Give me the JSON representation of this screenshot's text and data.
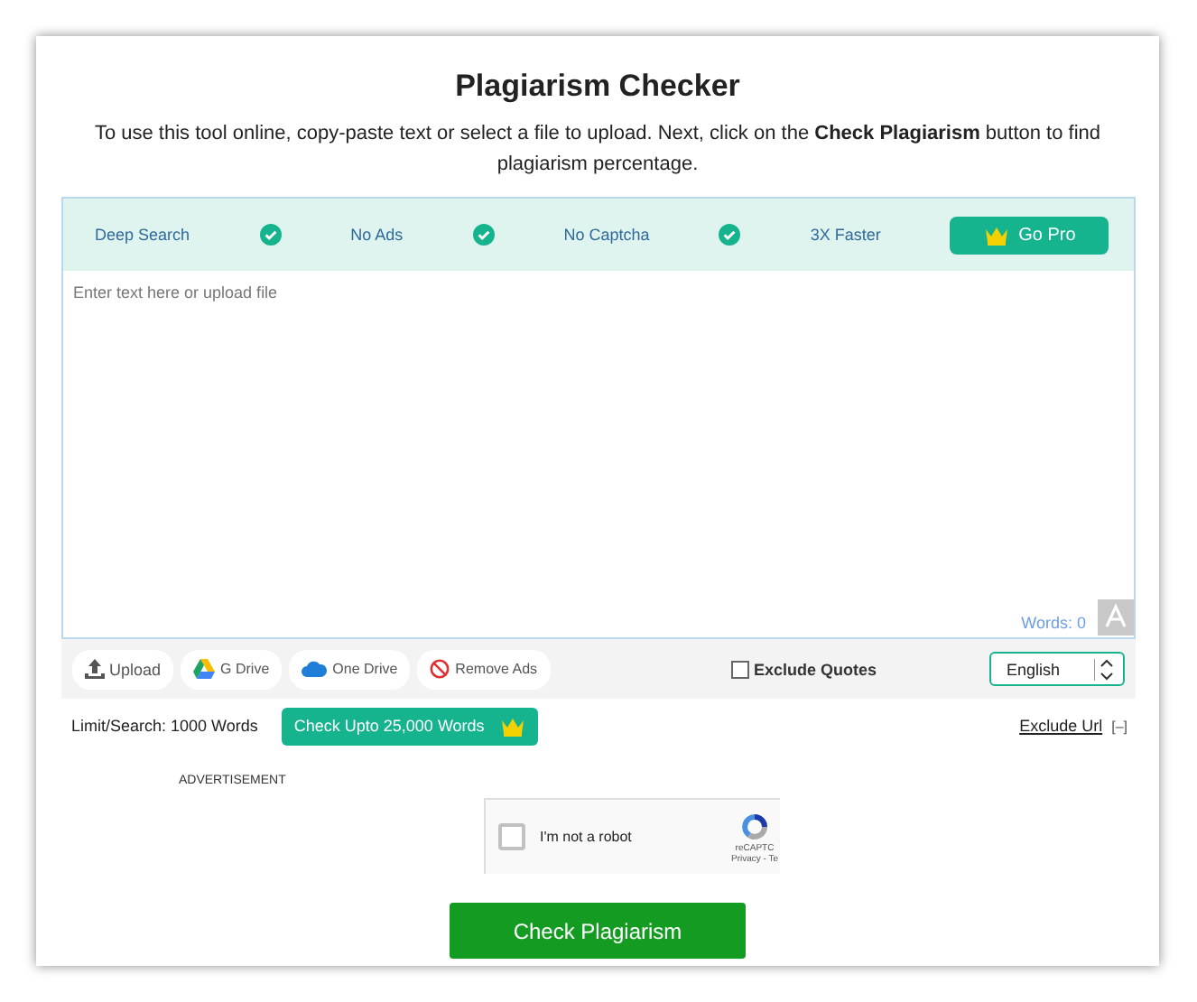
{
  "title": "Plagiarism Checker",
  "intro": "To use this tool online, copy-paste text or select a file to upload. Next, click on the **Check Plagiarism** button to find plagiarism percentage.",
  "features": [
    {
      "label": "Deep Search"
    },
    {
      "label": "No Ads"
    },
    {
      "label": "No Captcha"
    },
    {
      "label": "3X Faster"
    }
  ],
  "go_pro": "Go Pro",
  "editor": {
    "placeholder": "Enter text here or upload file",
    "word_count": "Words: 0"
  },
  "toolbar": [
    {
      "kind": "upload",
      "label": "Upload"
    },
    {
      "kind": "gdrive",
      "label": "G Drive"
    },
    {
      "kind": "onedrive",
      "label": "One Drive"
    },
    {
      "kind": "removeads",
      "label": "Remove Ads"
    }
  ],
  "exclude_quotes": {
    "label": "Exclude Quotes",
    "checked": false
  },
  "language": "English",
  "limit": "Limit/Search: 1000 Words",
  "upgrade": "Check Upto 25,000 Words",
  "exclude_url": "Exclude Url",
  "collapse": "[–]",
  "advertisement": "ADVERTISEMENT",
  "captcha": {
    "label": "I'm not a robot",
    "checked": false,
    "brand": "reCAPTC",
    "links": "Privacy - Te"
  },
  "submit": "Check Plagiarism"
}
